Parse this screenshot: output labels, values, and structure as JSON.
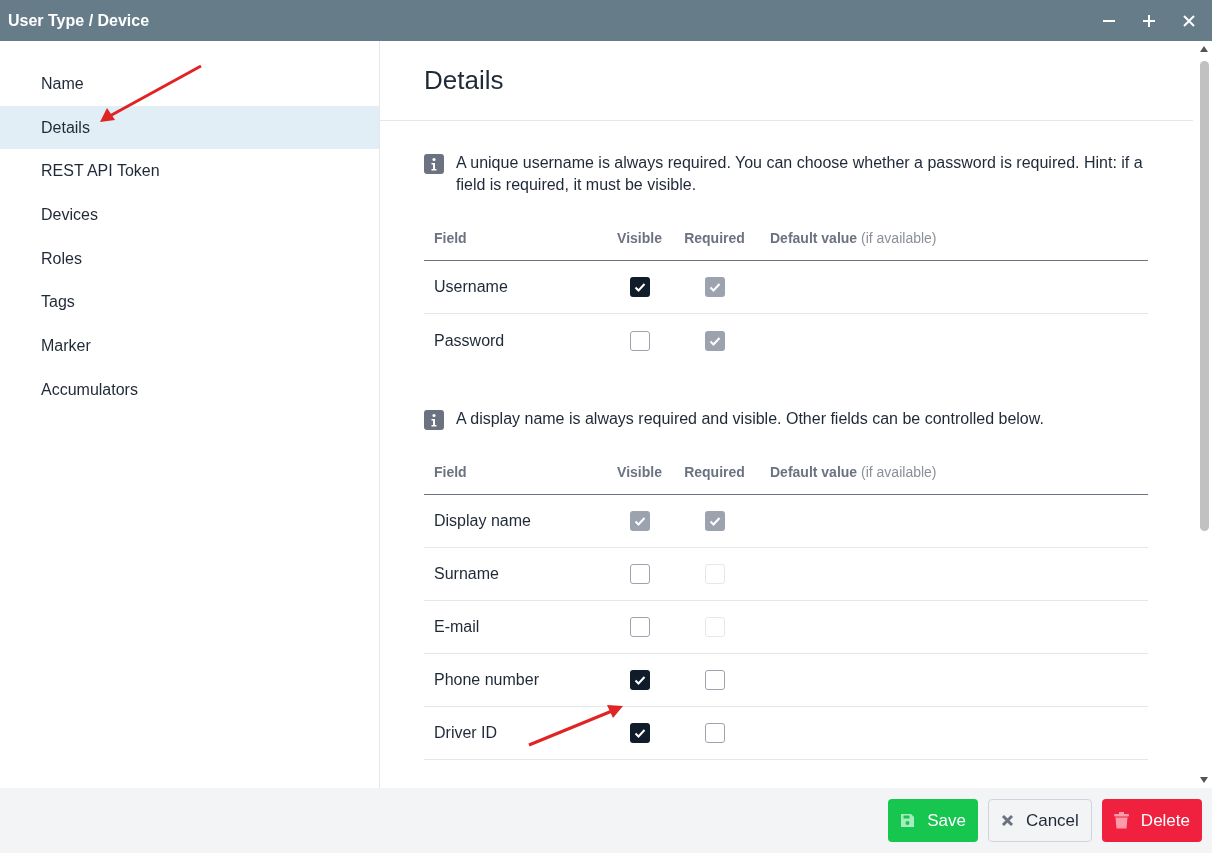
{
  "window": {
    "title": "User Type / Device"
  },
  "sidebar": {
    "items": [
      {
        "label": "Name",
        "selected": false
      },
      {
        "label": "Details",
        "selected": true
      },
      {
        "label": "REST API Token",
        "selected": false
      },
      {
        "label": "Devices",
        "selected": false
      },
      {
        "label": "Roles",
        "selected": false
      },
      {
        "label": "Tags",
        "selected": false
      },
      {
        "label": "Marker",
        "selected": false
      },
      {
        "label": "Accumulators",
        "selected": false
      }
    ]
  },
  "heading": "Details",
  "sections": [
    {
      "info": "A unique username is always required. You can choose whether a password is required. Hint: if a field is required, it must be visible.",
      "columns": [
        "Field",
        "Visible",
        "Required",
        "**Default value** (if available)"
      ],
      "rows": [
        {
          "field": "Username",
          "visible": {
            "checked": true,
            "disabled": false
          },
          "required": {
            "checked": true,
            "disabled": true
          }
        },
        {
          "field": "Password",
          "visible": {
            "checked": false,
            "disabled": false
          },
          "required": {
            "checked": true,
            "disabled": true
          }
        }
      ]
    },
    {
      "info": "A display name is always required and visible. Other fields can be controlled below.",
      "columns": [
        "Field",
        "Visible",
        "Required",
        "**Default value** (if available)"
      ],
      "rows": [
        {
          "field": "Display name",
          "visible": {
            "checked": true,
            "disabled": true
          },
          "required": {
            "checked": true,
            "disabled": true
          }
        },
        {
          "field": "Surname",
          "visible": {
            "checked": false,
            "disabled": false
          },
          "required": {
            "checked": false,
            "disabled": true
          }
        },
        {
          "field": "E-mail",
          "visible": {
            "checked": false,
            "disabled": false
          },
          "required": {
            "checked": false,
            "disabled": true
          }
        },
        {
          "field": "Phone number",
          "visible": {
            "checked": true,
            "disabled": false
          },
          "required": {
            "checked": false,
            "disabled": false
          }
        },
        {
          "field": "Driver ID",
          "visible": {
            "checked": true,
            "disabled": false
          },
          "required": {
            "checked": false,
            "disabled": false
          }
        }
      ]
    }
  ],
  "buttons": [
    {
      "kind": "save",
      "label": "Save"
    },
    {
      "kind": "cancel",
      "label": "Cancel"
    },
    {
      "kind": "delete",
      "label": "Delete"
    }
  ]
}
